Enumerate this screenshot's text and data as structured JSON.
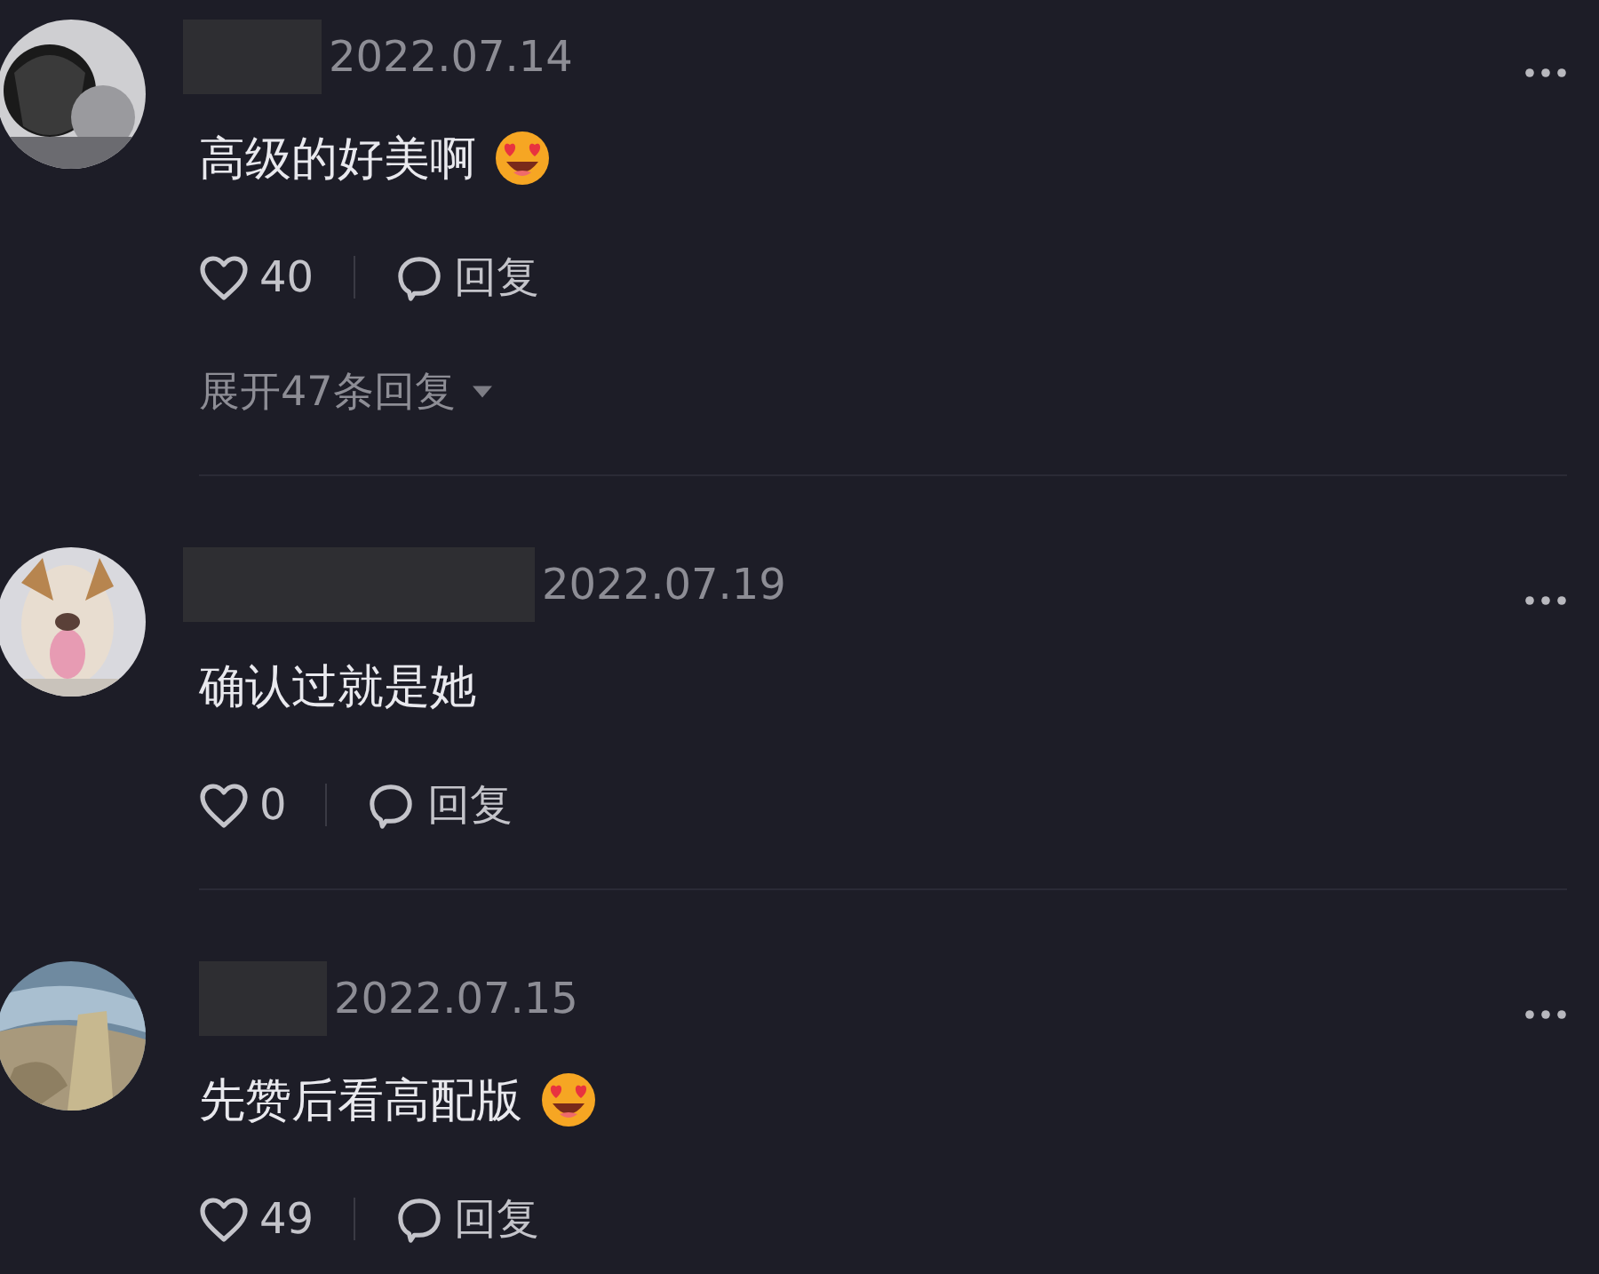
{
  "comments": [
    {
      "name_redacted": true,
      "date": "2022.07.14",
      "text": "高级的好美啊",
      "emoji": true,
      "likes": "40",
      "reply_label": "回复",
      "expand": "展开47条回复"
    },
    {
      "name_redacted": true,
      "date": "2022.07.19",
      "text": "确认过就是她",
      "emoji": false,
      "likes": "0",
      "reply_label": "回复"
    },
    {
      "name_redacted": true,
      "date": "2022.07.15",
      "text": "先赞后看高配版",
      "emoji": true,
      "likes": "49",
      "reply_label": "回复"
    }
  ]
}
